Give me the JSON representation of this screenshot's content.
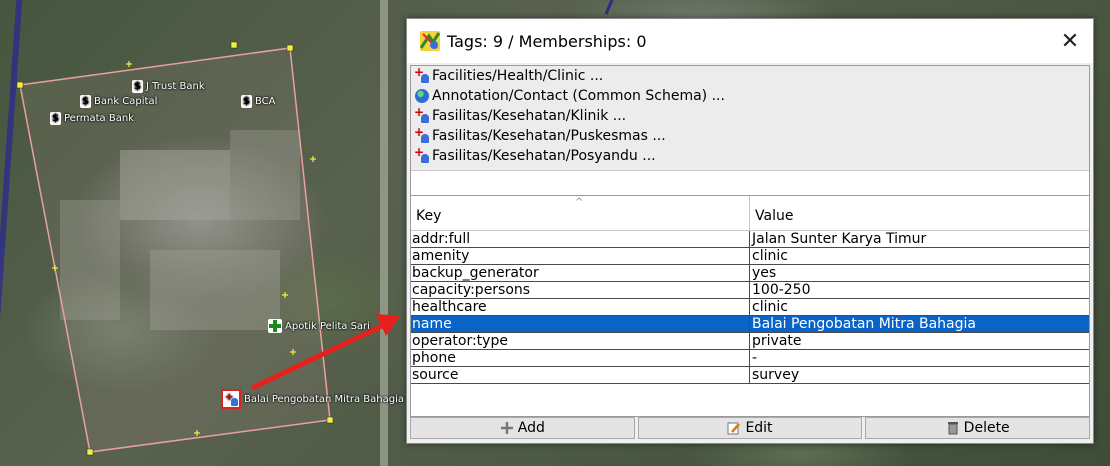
{
  "map": {
    "pins": {
      "trust_bank": "J Trust Bank",
      "bank_capital": "Bank Capital",
      "bca": "BCA",
      "permata": "Permata Bank",
      "apotik": "Apotik Pelita Sari",
      "clinic": "Balai Pengobatan Mitra Bahagia"
    },
    "bank_icon_glyph": "$",
    "colors": {
      "selection_outline": "#e8a0a0",
      "node": "#f0f040",
      "arrow": "#e8201c"
    }
  },
  "dialog": {
    "title": "Tags: 9 / Memberships: 0",
    "close_glyph": "✕",
    "presets": [
      {
        "icon": "clinic-preset-icon",
        "label": "Facilities/Health/Clinic ..."
      },
      {
        "icon": "globe-icon",
        "label": "Annotation/Contact (Common Schema) ..."
      },
      {
        "icon": "clinic-preset-icon",
        "label": "Fasilitas/Kesehatan/Klinik ..."
      },
      {
        "icon": "clinic-preset-icon",
        "label": "Fasilitas/Kesehatan/Puskesmas ..."
      },
      {
        "icon": "clinic-preset-icon",
        "label": "Fasilitas/Kesehatan/Posyandu ..."
      }
    ],
    "table": {
      "key_header": "Key",
      "value_header": "Value",
      "sort_glyph": "^",
      "rows": [
        {
          "key": "addr:full",
          "value": "Jalan Sunter Karya Timur"
        },
        {
          "key": "amenity",
          "value": "clinic"
        },
        {
          "key": "backup_generator",
          "value": "yes"
        },
        {
          "key": "capacity:persons",
          "value": "100-250"
        },
        {
          "key": "healthcare",
          "value": "clinic"
        },
        {
          "key": "name",
          "value": "Balai Pengobatan Mitra Bahagia",
          "selected": true
        },
        {
          "key": "operator:type",
          "value": "private"
        },
        {
          "key": "phone",
          "value": "-"
        },
        {
          "key": "source",
          "value": "survey"
        }
      ]
    },
    "buttons": {
      "add": "Add",
      "edit": "Edit",
      "delete": "Delete"
    },
    "colors": {
      "selection": "#0a64c8"
    }
  }
}
